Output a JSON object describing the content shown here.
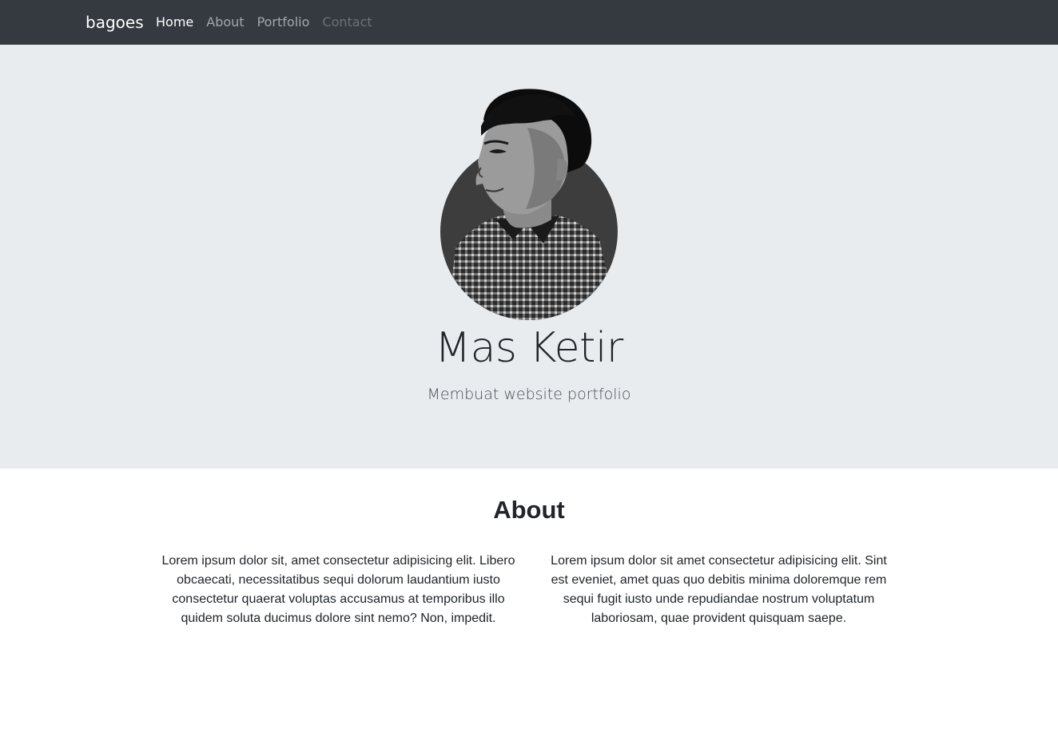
{
  "navbar": {
    "brand": "bagoes",
    "links": [
      "Home",
      "About",
      "Portfolio",
      "Contact"
    ]
  },
  "hero": {
    "avatar_icon": "profile-photo",
    "name": "Mas Ketir",
    "subtitle": "Membuat website portfolio"
  },
  "about": {
    "title": "About",
    "paragraphs": [
      "Lorem ipsum dolor sit, amet consectetur adipisicing elit. Libero obcaecati, necessitatibus sequi dolorum laudantium iusto consectetur quaerat voluptas accusamus at temporibus illo quidem soluta ducimus dolore sint nemo? Non, impedit.",
      "Lorem ipsum dolor sit amet consectetur adipisicing elit. Sint est eveniet, amet quas quo debitis minima doloremque rem sequi fugit iusto unde repudiandae nostrum voluptatum laboriosam, quae provident quisquam saepe."
    ]
  },
  "colors": {
    "navbar_bg": "#343a40",
    "hero_bg": "#e9ecef",
    "text": "#212529"
  }
}
